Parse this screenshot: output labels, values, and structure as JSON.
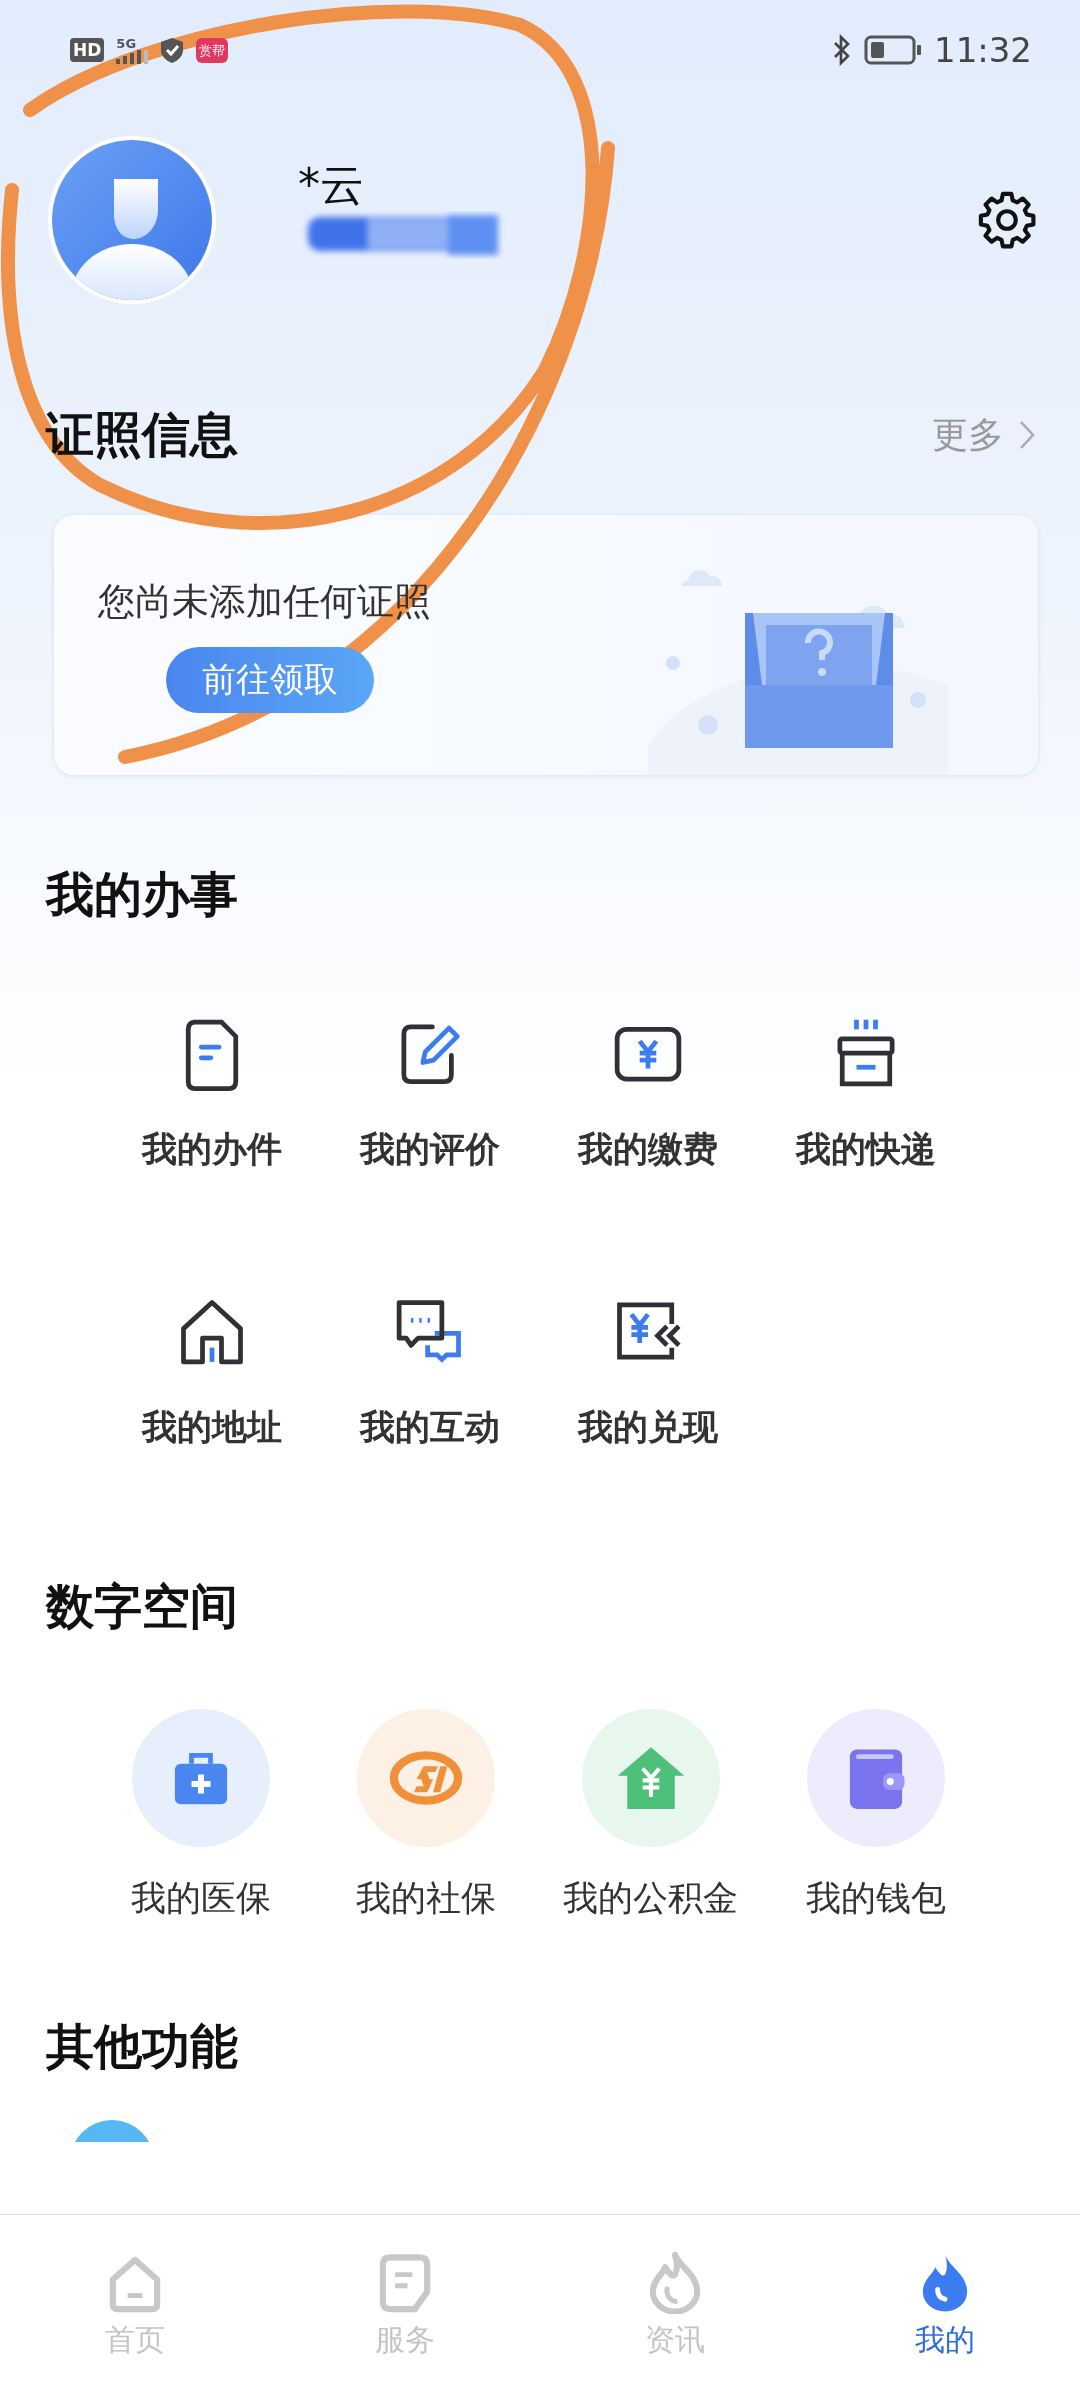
{
  "status_bar": {
    "network": "HD",
    "signal": "5G",
    "app_badge": "赏帮",
    "time": "11:32"
  },
  "profile": {
    "name": "*云",
    "name_hidden": true
  },
  "license_section": {
    "title": "证照信息",
    "more": "更多",
    "empty_text": "您尚未添加任何证照",
    "button": "前往领取"
  },
  "affairs_section": {
    "title": "我的办事",
    "items": [
      {
        "label": "我的办件",
        "kind": "file"
      },
      {
        "label": "我的评价",
        "kind": "edit"
      },
      {
        "label": "我的缴费",
        "kind": "payment"
      },
      {
        "label": "我的快递",
        "kind": "express"
      },
      {
        "label": "我的地址",
        "kind": "home"
      },
      {
        "label": "我的互动",
        "kind": "chat"
      },
      {
        "label": "我的兑现",
        "kind": "cashout"
      }
    ]
  },
  "digital_section": {
    "title": "数字空间",
    "items": [
      {
        "label": "我的医保",
        "kind": "medical",
        "color": "#4a86f0"
      },
      {
        "label": "我的社保",
        "kind": "social",
        "color": "#f0913a"
      },
      {
        "label": "我的公积金",
        "kind": "fund",
        "color": "#4ec07a"
      },
      {
        "label": "我的钱包",
        "kind": "wallet",
        "color": "#7a74ee"
      }
    ]
  },
  "other_section": {
    "title": "其他功能"
  },
  "tabs": [
    {
      "label": "首页",
      "kind": "home",
      "selected": false
    },
    {
      "label": "服务",
      "kind": "service",
      "selected": false
    },
    {
      "label": "资讯",
      "kind": "news",
      "selected": false
    },
    {
      "label": "我的",
      "kind": "mine",
      "selected": true
    }
  ],
  "annotation": {
    "kind": "freehand"
  }
}
